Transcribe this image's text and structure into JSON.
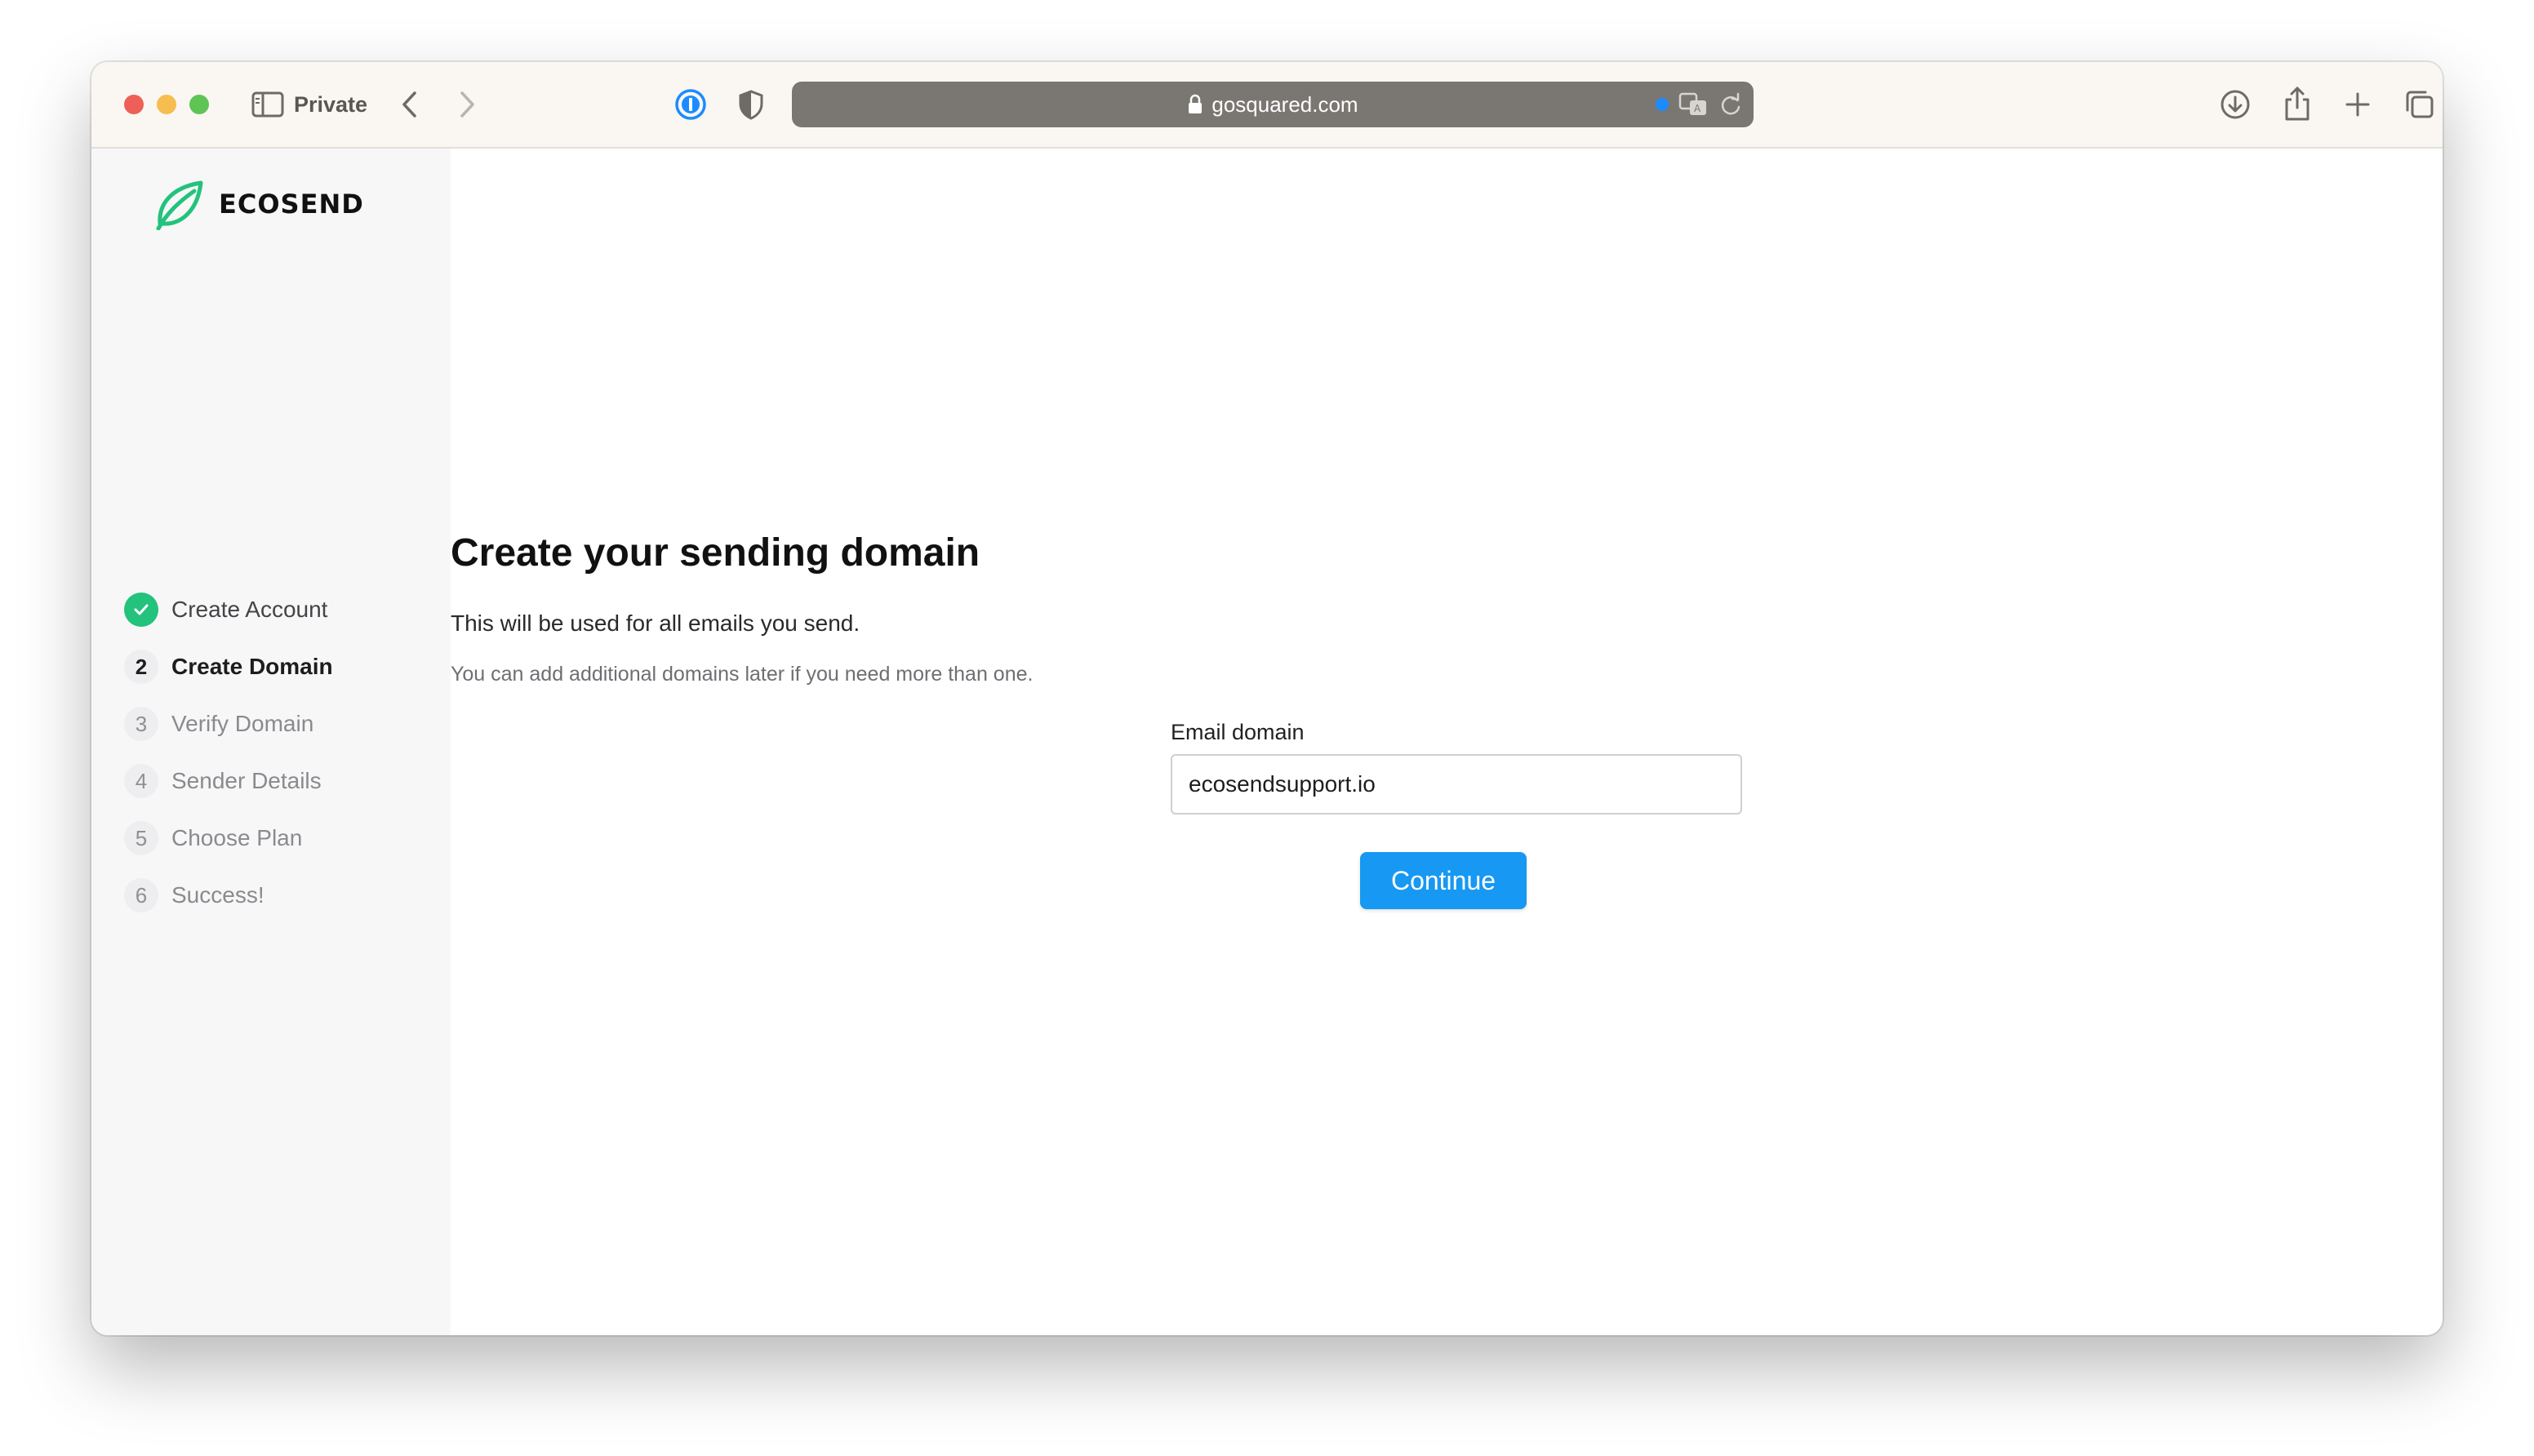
{
  "browser": {
    "private_label": "Private",
    "url": "gosquared.com"
  },
  "brand": {
    "name": "ECOSEND",
    "accent": "#23c27d"
  },
  "steps": [
    {
      "num": "",
      "label": "Create Account",
      "state": "done"
    },
    {
      "num": "2",
      "label": "Create Domain",
      "state": "active"
    },
    {
      "num": "3",
      "label": "Verify Domain",
      "state": "pending"
    },
    {
      "num": "4",
      "label": "Sender Details",
      "state": "pending"
    },
    {
      "num": "5",
      "label": "Choose Plan",
      "state": "pending"
    },
    {
      "num": "6",
      "label": "Success!",
      "state": "pending"
    }
  ],
  "main": {
    "title": "Create your sending domain",
    "subtitle": "This will be used for all emails you send.",
    "note": "You can add additional domains later if you need more than one.",
    "field_label": "Email domain",
    "field_value": "ecosendsupport.io",
    "continue_label": "Continue"
  },
  "colors": {
    "primary": "#1798f2",
    "check": "#23c27d"
  }
}
